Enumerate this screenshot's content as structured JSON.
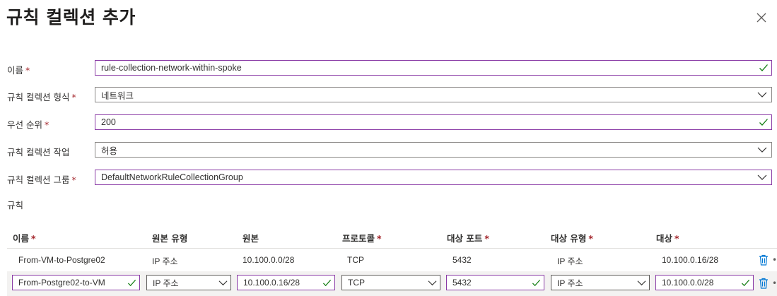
{
  "dialog": {
    "title": "규칙 컬렉션 추가"
  },
  "form": {
    "name_label": "이름",
    "name_value": "rule-collection-network-within-spoke",
    "type_label": "규칙 컬렉션 형식",
    "type_value": "네트워크",
    "priority_label": "우선 순위",
    "priority_value": "200",
    "action_label": "규칙 컬렉션 작업",
    "action_value": "허용",
    "group_label": "규칙 컬렉션 그룹",
    "group_value": "DefaultNetworkRuleCollectionGroup",
    "required_mark": "*"
  },
  "rules": {
    "section_label": "규칙",
    "columns": {
      "name": "이름",
      "source_type": "원본 유형",
      "source": "원본",
      "protocol": "프로토콜",
      "dest_port": "대상 포트",
      "dest_type": "대상 유형",
      "dest": "대상"
    },
    "rows": [
      {
        "name": "From-VM-to-Postgre02",
        "source_type": "IP 주소",
        "source": "10.100.0.0/28",
        "protocol": "TCP",
        "dest_port": "5432",
        "dest_type": "IP 주소",
        "dest": "10.100.0.16/28"
      },
      {
        "name": "From-Postgre02-to-VM",
        "source_type": "IP 주소",
        "source": "10.100.0.16/28",
        "protocol": "TCP",
        "dest_port": "5432",
        "dest_type": "IP 주소",
        "dest": "10.100.0.0/28"
      }
    ]
  },
  "colors": {
    "accent_border": "#8a3ba6",
    "valid_check": "#107c10",
    "required": "#a4262c",
    "delete_icon": "#0078d4"
  }
}
